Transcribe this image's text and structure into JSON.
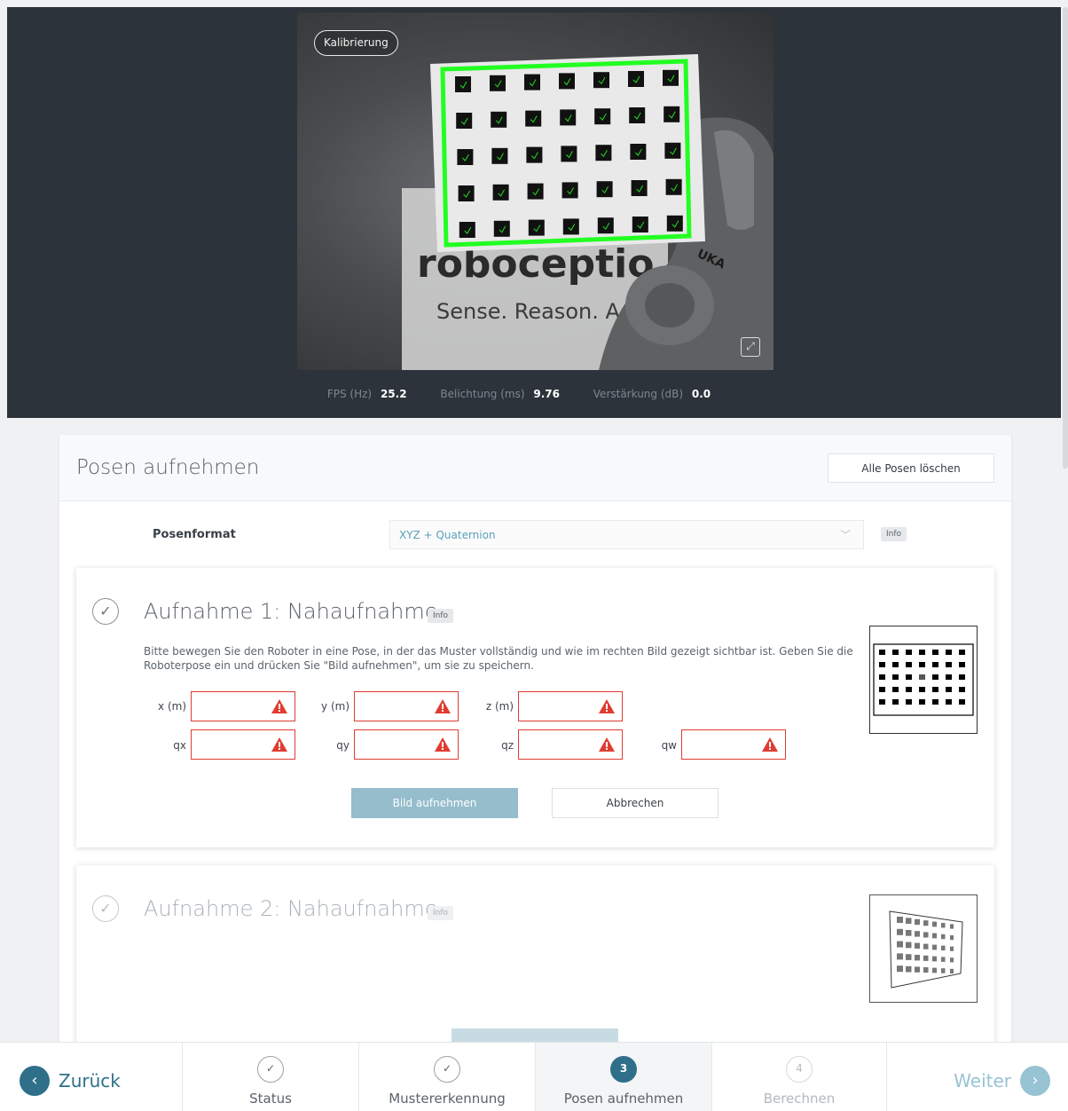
{
  "camera": {
    "badge": "Kalibrierung",
    "scene_text": {
      "brand": "roboceptio",
      "slogan": "Sense. Reason. A",
      "robot_mark": "UKA"
    },
    "stats": [
      {
        "label": "FPS (Hz)",
        "value": "25.2"
      },
      {
        "label": "Belichtung (ms)",
        "value": "9.76"
      },
      {
        "label": "Verstärkung (dB)",
        "value": "0.0"
      }
    ]
  },
  "panel": {
    "title": "Posen aufnehmen",
    "clear_button": "Alle Posen löschen",
    "format_label": "Posenformat",
    "format_value": "XYZ + Quaternion",
    "info": "Info"
  },
  "capture1": {
    "title": "Aufnahme 1: Nahaufnahme",
    "info": "Info",
    "description": "Bitte bewegen Sie den Roboter in eine Pose, in der das Muster vollständig und wie im rechten Bild gezeigt sichtbar ist. Geben Sie die Roboterpose ein und drücken Sie \"Bild aufnehmen\", um sie zu speichern.",
    "fields": {
      "x": {
        "label": "x (m)",
        "value": ""
      },
      "y": {
        "label": "y (m)",
        "value": ""
      },
      "z": {
        "label": "z (m)",
        "value": ""
      },
      "qx": {
        "label": "qx",
        "value": ""
      },
      "qy": {
        "label": "qy",
        "value": ""
      },
      "qz": {
        "label": "qz",
        "value": ""
      },
      "qw": {
        "label": "qw",
        "value": ""
      }
    },
    "capture_button": "Bild aufnehmen",
    "cancel_button": "Abbrechen"
  },
  "capture2": {
    "title": "Aufnahme 2: Nahaufnahme",
    "info": "Info"
  },
  "nav": {
    "back": "Zurück",
    "next": "Weiter",
    "steps": [
      {
        "num": "✓",
        "label": "Status",
        "state": "done"
      },
      {
        "num": "✓",
        "label": "Mustererkennung",
        "state": "done"
      },
      {
        "num": "3",
        "label": "Posen aufnehmen",
        "state": "active"
      },
      {
        "num": "4",
        "label": "Berechnen",
        "state": "disabled"
      }
    ]
  },
  "colors": {
    "accent": "#2f6f8a",
    "accent_light": "#97c3d3",
    "error": "#e03c31",
    "detect_green": "#22ff22",
    "dark_bg": "#2d333b"
  }
}
